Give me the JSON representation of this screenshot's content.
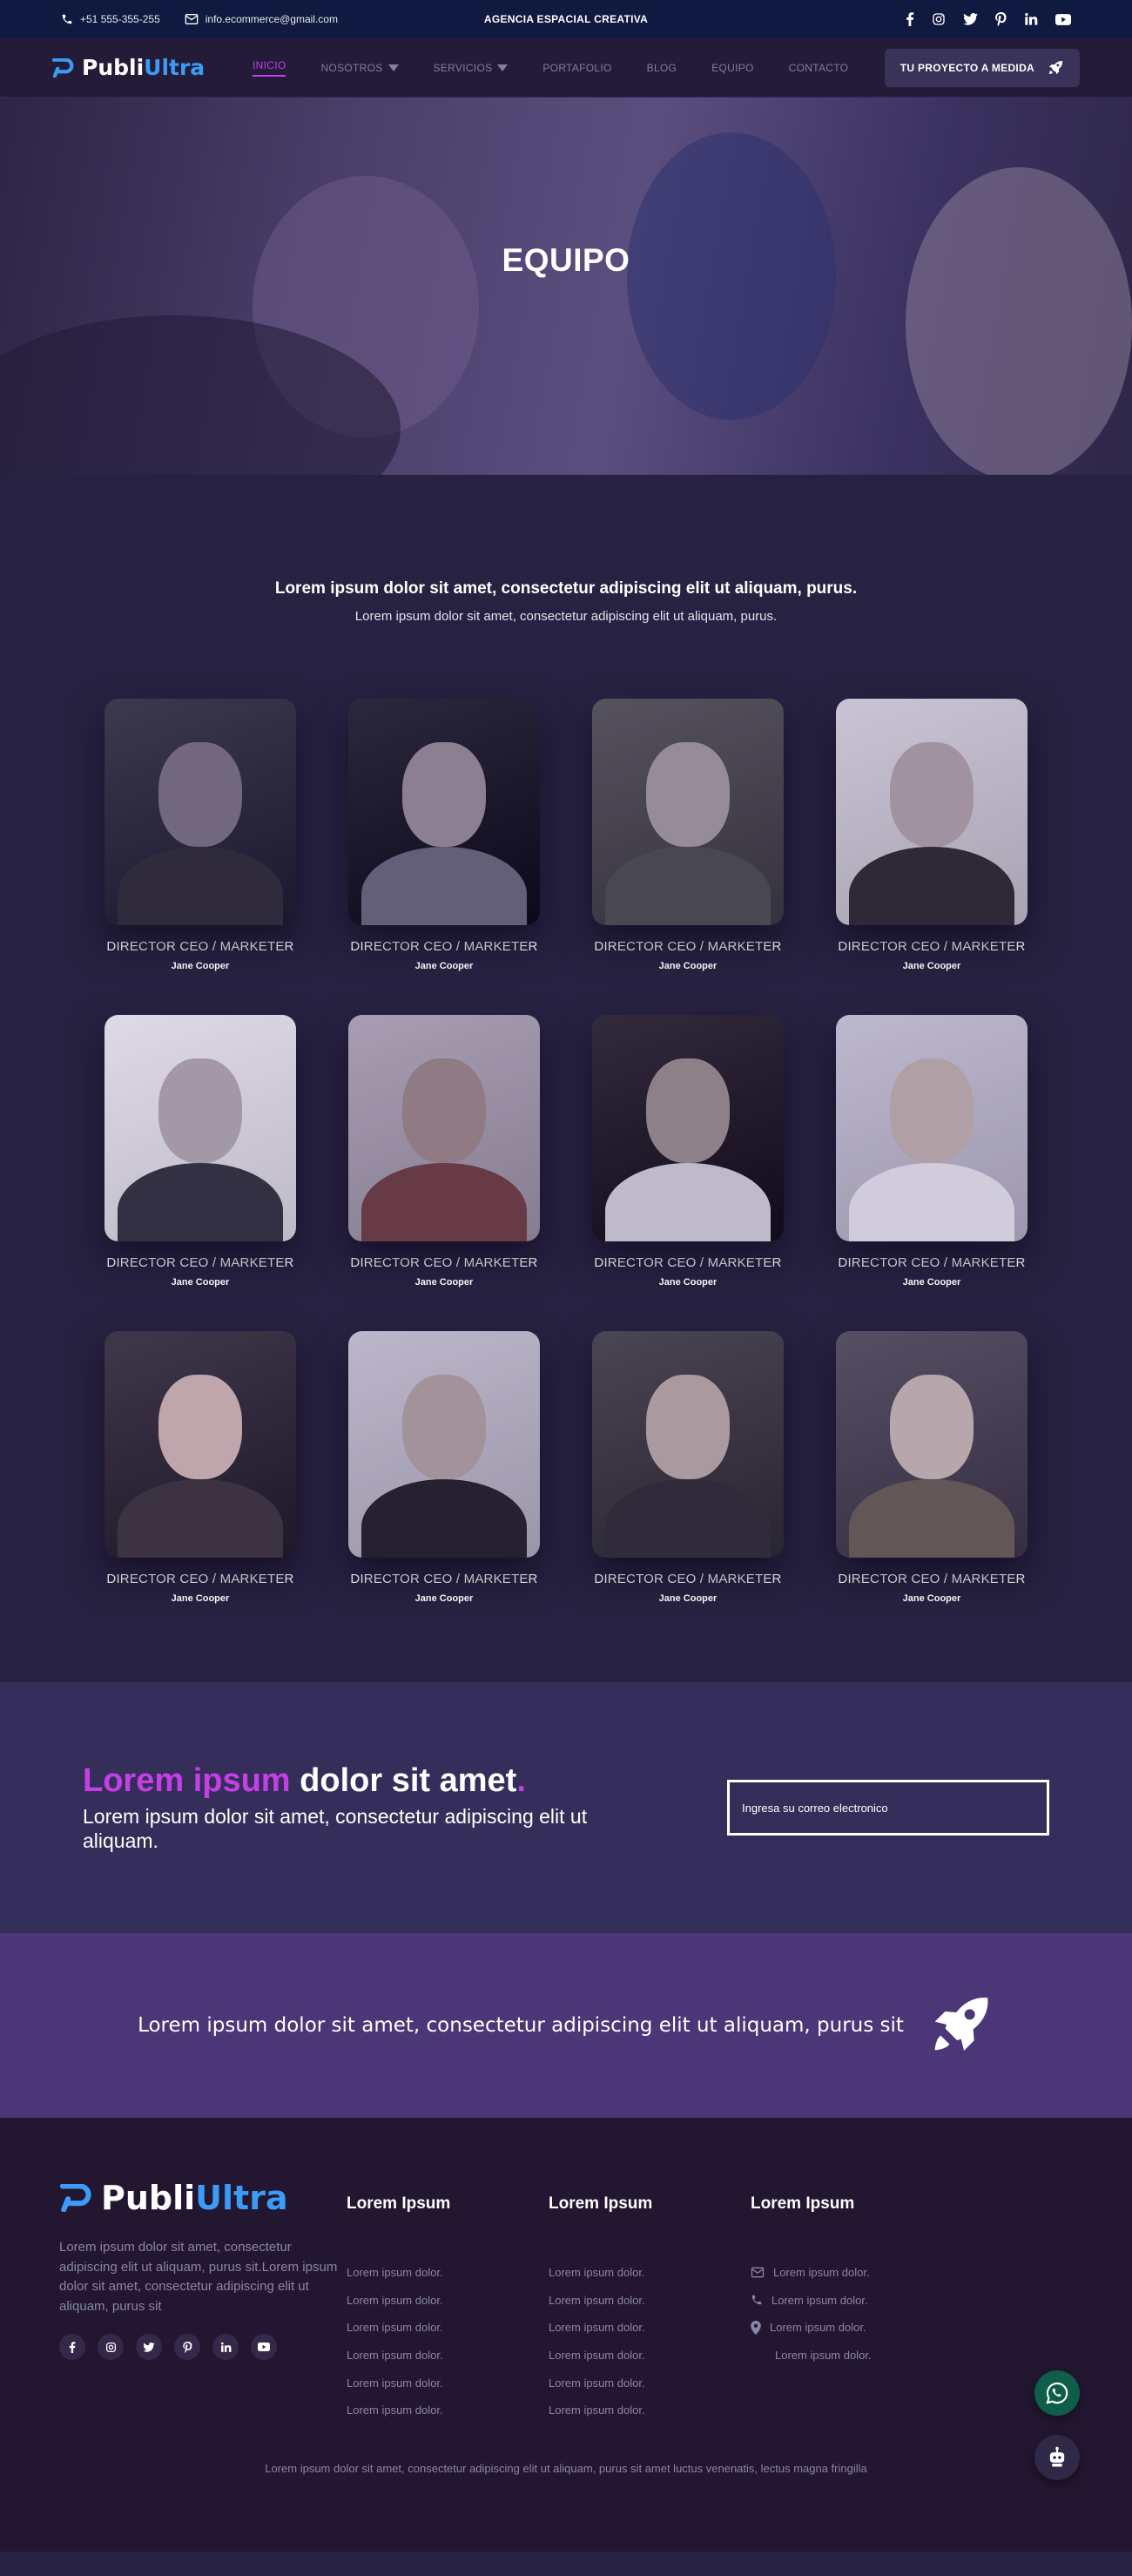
{
  "topbar": {
    "phone": "+51 555-355-255",
    "email": "info.ecommerce@gmail.com",
    "tagline": "AGENCIA ESPACIAL CREATIVA",
    "social_icons": [
      "facebook-icon",
      "instagram-icon",
      "twitter-icon",
      "pinterest-icon",
      "linkedin-icon",
      "youtube-icon"
    ]
  },
  "nav": {
    "logo_part1": "Publi",
    "logo_part2": "Ultra",
    "items": [
      "INICIO",
      "NOSOTROS",
      "SERVICIOS",
      "PORTAFOLIO",
      "BLOG",
      "EQUIPO",
      "CONTACTO"
    ],
    "cta": "TU PROYECTO A MEDIDA"
  },
  "hero": {
    "title": "EQUIPO"
  },
  "team": {
    "lead": "Lorem ipsum dolor sit amet, consectetur adipiscing elit ut aliquam, purus.",
    "sub": "Lorem ipsum dolor sit amet, consectetur adipiscing elit ut aliquam, purus.",
    "members": [
      {
        "role": "DIRECTOR CEO / MARKETER",
        "name": "Jane Cooper"
      },
      {
        "role": "DIRECTOR CEO / MARKETER",
        "name": "Jane Cooper"
      },
      {
        "role": "DIRECTOR CEO / MARKETER",
        "name": "Jane Cooper"
      },
      {
        "role": "DIRECTOR CEO / MARKETER",
        "name": "Jane Cooper"
      },
      {
        "role": "DIRECTOR CEO / MARKETER",
        "name": "Jane Cooper"
      },
      {
        "role": "DIRECTOR CEO / MARKETER",
        "name": "Jane Cooper"
      },
      {
        "role": "DIRECTOR CEO / MARKETER",
        "name": "Jane Cooper"
      },
      {
        "role": "DIRECTOR CEO / MARKETER",
        "name": "Jane Cooper"
      },
      {
        "role": "DIRECTOR CEO / MARKETER",
        "name": "Jane Cooper"
      },
      {
        "role": "DIRECTOR CEO / MARKETER",
        "name": "Jane Cooper"
      },
      {
        "role": "DIRECTOR CEO / MARKETER",
        "name": "Jane Cooper"
      },
      {
        "role": "DIRECTOR CEO / MARKETER",
        "name": "Jane Cooper"
      }
    ]
  },
  "newsletter": {
    "title_pink": "Lorem ipsum",
    "title_white": "dolor sit amet",
    "title_dot": ".",
    "text": "Lorem ipsum dolor sit amet, consectetur adipiscing elit ut aliquam.",
    "placeholder": "Ingresa su  correo electronico"
  },
  "banner": {
    "text": "Lorem ipsum dolor sit amet, consectetur adipiscing elit ut aliquam, purus sit"
  },
  "footer": {
    "about": "Lorem ipsum dolor sit amet, consectetur adipiscing elit ut aliquam, purus sit.Lorem ipsum dolor sit amet, consectetur adipiscing elit ut aliquam, purus sit",
    "col1": {
      "title": "Lorem Ipsum",
      "links": [
        "Lorem ipsum dolor.",
        "Lorem ipsum dolor.",
        "Lorem ipsum dolor.",
        "Lorem ipsum dolor.",
        "Lorem ipsum dolor.",
        "Lorem ipsum dolor."
      ]
    },
    "col2": {
      "title": "Lorem Ipsum",
      "links": [
        "Lorem ipsum dolor.",
        "Lorem ipsum dolor.",
        "Lorem ipsum dolor.",
        "Lorem ipsum dolor.",
        "Lorem ipsum dolor.",
        "Lorem ipsum dolor."
      ]
    },
    "col3": {
      "title": "Lorem Ipsum",
      "links": [
        "Lorem ipsum dolor.",
        "Lorem ipsum dolor.",
        "Lorem ipsum dolor.",
        "Lorem ipsum dolor."
      ]
    },
    "copyright": "Lorem ipsum dolor sit amet, consectetur adipiscing elit ut aliquam, purus sit amet luctus venenatis, lectus magna fringilla"
  },
  "colors": {
    "accent": "#c43fe8",
    "logo_blue": "#3b9bf5",
    "whatsapp": "#0f5e4a"
  }
}
